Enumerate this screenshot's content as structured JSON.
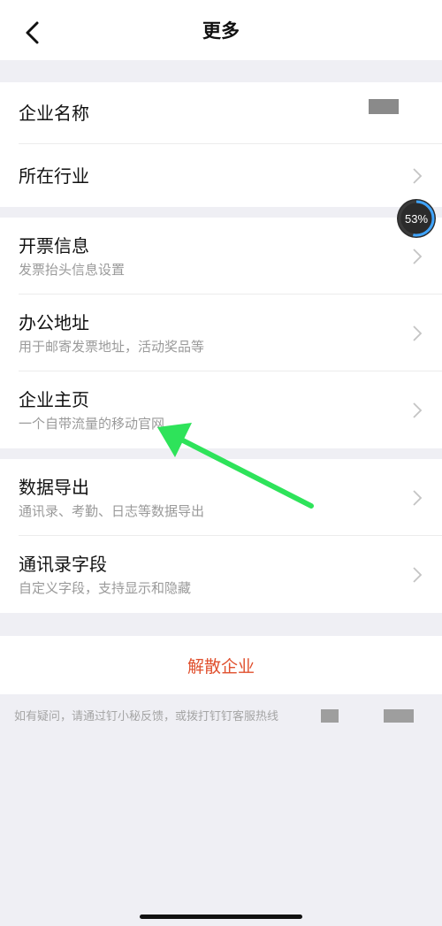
{
  "nav": {
    "title": "更多",
    "back_icon": "chevron-left-icon"
  },
  "section1": [
    {
      "label": "企业名称",
      "value_redacted": true
    },
    {
      "label": "所在行业",
      "has_chevron": true
    }
  ],
  "section2": [
    {
      "label": "开票信息",
      "sub": "发票抬头信息设置"
    },
    {
      "label": "办公地址",
      "sub": "用于邮寄发票地址，活动奖品等"
    },
    {
      "label": "企业主页",
      "sub": "一个自带流量的移动官网"
    }
  ],
  "section3": [
    {
      "label": "数据导出",
      "sub": "通讯录、考勤、日志等数据导出"
    },
    {
      "label": "通讯录字段",
      "sub": "自定义字段，支持显示和隐藏"
    }
  ],
  "dissolve": {
    "label": "解散企业"
  },
  "footer": {
    "text": "如有疑问，请通过钉小秘反馈，或拨打钉钉客服热线"
  },
  "badge": {
    "text": "53%",
    "value": 53
  },
  "colors": {
    "danger": "#e0502e",
    "arrow": "#2ee35a",
    "subtext": "#9a9a9a"
  }
}
